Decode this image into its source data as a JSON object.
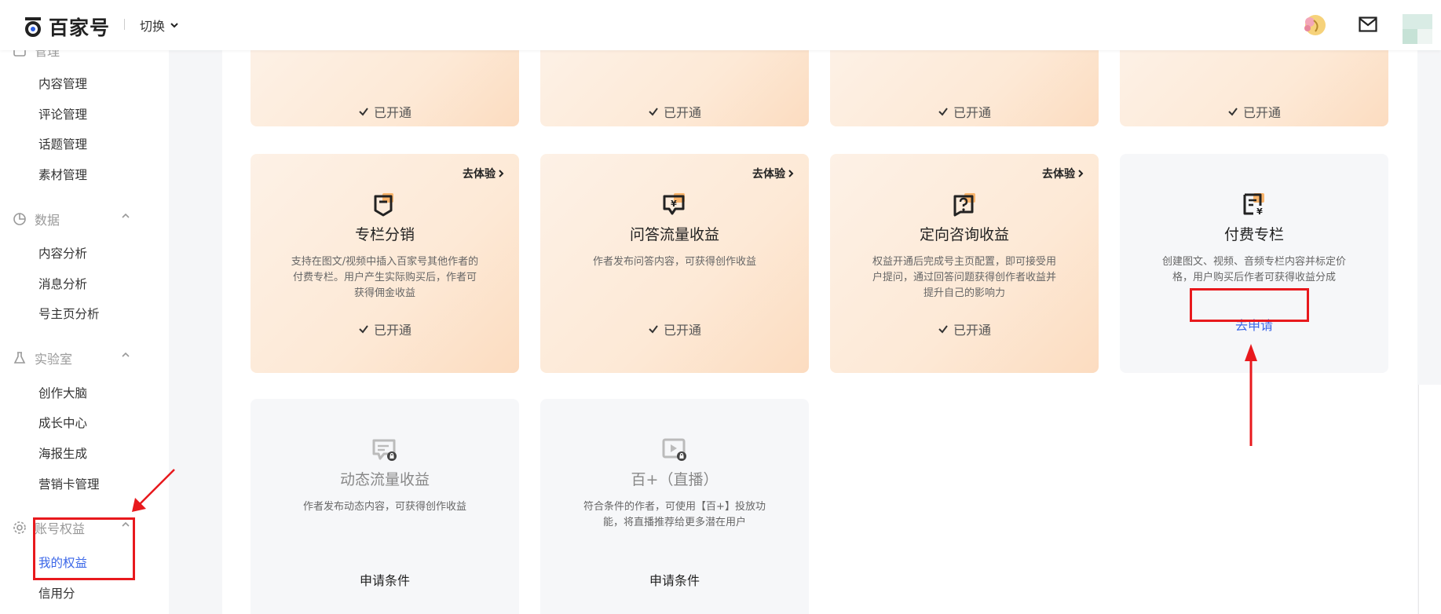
{
  "header": {
    "brand": "百家号",
    "switch_label": "切换"
  },
  "sidebar": {
    "partial_top": "管理",
    "manage_items": [
      "内容管理",
      "评论管理",
      "话题管理",
      "素材管理"
    ],
    "data_group": "数据",
    "data_items": [
      "内容分析",
      "消息分析",
      "号主页分析"
    ],
    "lab_group": "实验室",
    "lab_items": [
      "创作大脑",
      "成长中心",
      "海报生成",
      "营销卡管理"
    ],
    "rights_group": "账号权益",
    "rights_items": [
      "我的权益",
      "信用分"
    ]
  },
  "top_row": {
    "status": [
      "已开通",
      "已开通",
      "已开通",
      "已开通"
    ]
  },
  "cards": [
    {
      "try_label": "去体验",
      "title": "专栏分销",
      "desc": "支持在图文/视频中插入百家号其他作者的付费专栏。用户产生实际购买后，作者可获得佣金收益",
      "status": "已开通"
    },
    {
      "try_label": "去体验",
      "title": "问答流量收益",
      "desc": "作者发布问答内容，可获得创作收益",
      "status": "已开通"
    },
    {
      "try_label": "去体验",
      "title": "定向咨询收益",
      "desc": "权益开通后完成号主页配置，即可接受用户提问，通过回答问题获得创作者收益并提升自己的影响力",
      "status": "已开通"
    },
    {
      "title": "付费专栏",
      "desc": "创建图文、视频、音频专栏内容并标定价格，用户购买后作者可获得收益分成",
      "apply": "去申请"
    },
    {
      "title": "动态流量收益",
      "desc": "作者发布动态内容，可获得创作收益",
      "cond": "申请条件"
    },
    {
      "title": "百+（直播）",
      "desc": "符合条件的作者，可使用【百+】投放功能，将直播推荐给更多潜在用户",
      "cond": "申请条件"
    }
  ],
  "colors": {
    "accent": "#3a66e8",
    "annotation": "#e8191d",
    "card_orange": "#fde9d6"
  }
}
